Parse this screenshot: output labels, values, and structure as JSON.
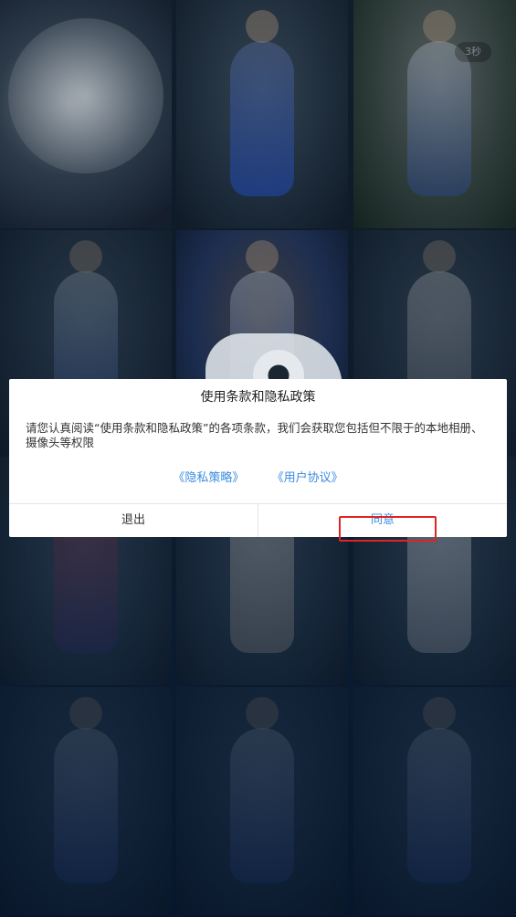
{
  "splash": {
    "countdown": "3秒"
  },
  "dialog": {
    "title": "使用条款和隐私政策",
    "body": "请您认真阅读“使用条款和隐私政策”的各项条款，我们会获取您包括但不限于的本地相册、摄像头等权限",
    "privacy_link": "《隐私策略》",
    "user_agreement_link": "《用户协议》",
    "exit_label": "退出",
    "agree_label": "同意"
  },
  "colors": {
    "link": "#3a8be0",
    "highlight": "#e02424",
    "background": "#0a1a2c"
  }
}
